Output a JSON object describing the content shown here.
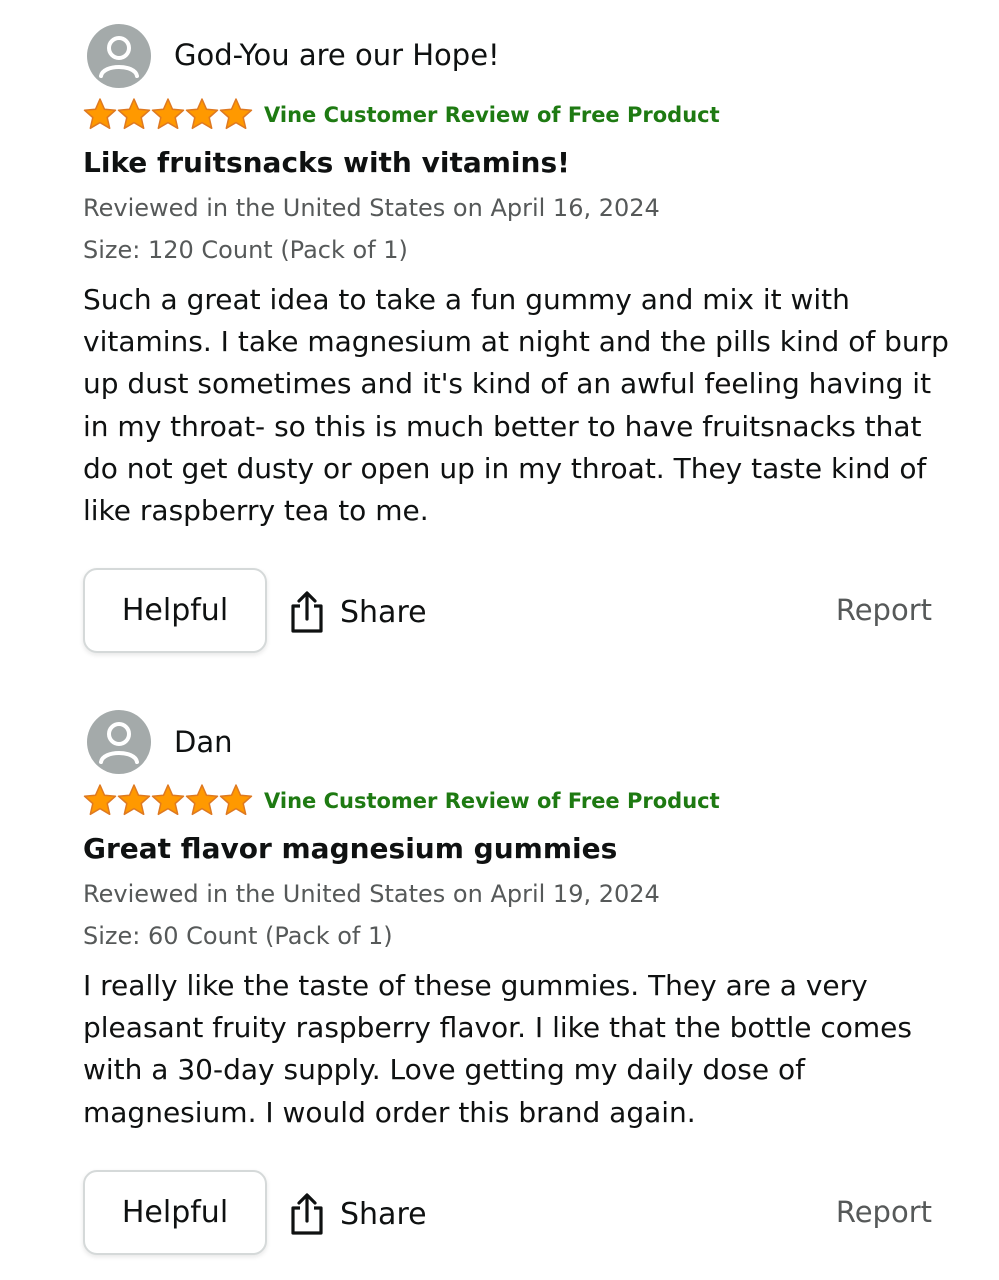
{
  "reviews": [
    {
      "reviewer": "God-You are our Hope!",
      "rating": 5,
      "badge": "Vine Customer Review of Free Product",
      "title": "Like fruitsnacks with vitamins!",
      "date_line": "Reviewed in the United States on April 16, 2024",
      "size_line": "Size: 120 Count (Pack of 1)",
      "body": "Such a great idea to take a fun gummy and mix it with vitamins. I take magnesium at night and the pills kind of burp up dust sometimes and it's kind of an awful feeling having it in my throat- so this is much better to have fruitsnacks that do not get dusty or open up in my throat. They taste kind of like raspberry tea to me.",
      "helpful_label": "Helpful",
      "share_label": "Share",
      "report_label": "Report"
    },
    {
      "reviewer": "Dan",
      "rating": 5,
      "badge": "Vine Customer Review of Free Product",
      "title": "Great flavor magnesium gummies",
      "date_line": "Reviewed in the United States on April 19, 2024",
      "size_line": "Size: 60 Count (Pack of 1)",
      "body": "I really like the taste of these gummies. They are a very pleasant fruity raspberry flavor. I like that the bottle comes with a 30-day supply. Love getting my daily dose of magnesium. I would order this brand again.",
      "helpful_label": "Helpful",
      "share_label": "Share",
      "report_label": "Report"
    }
  ],
  "icons": {
    "avatar": "default-user-icon",
    "star": "star-icon",
    "share": "share-icon"
  },
  "colors": {
    "star": "#ff9900",
    "star_outline": "#de7921",
    "vine_badge": "#1e7a12",
    "meta_text": "#565959",
    "button_border": "#d5d9d9",
    "avatar_bg": "#a4aaaa"
  }
}
